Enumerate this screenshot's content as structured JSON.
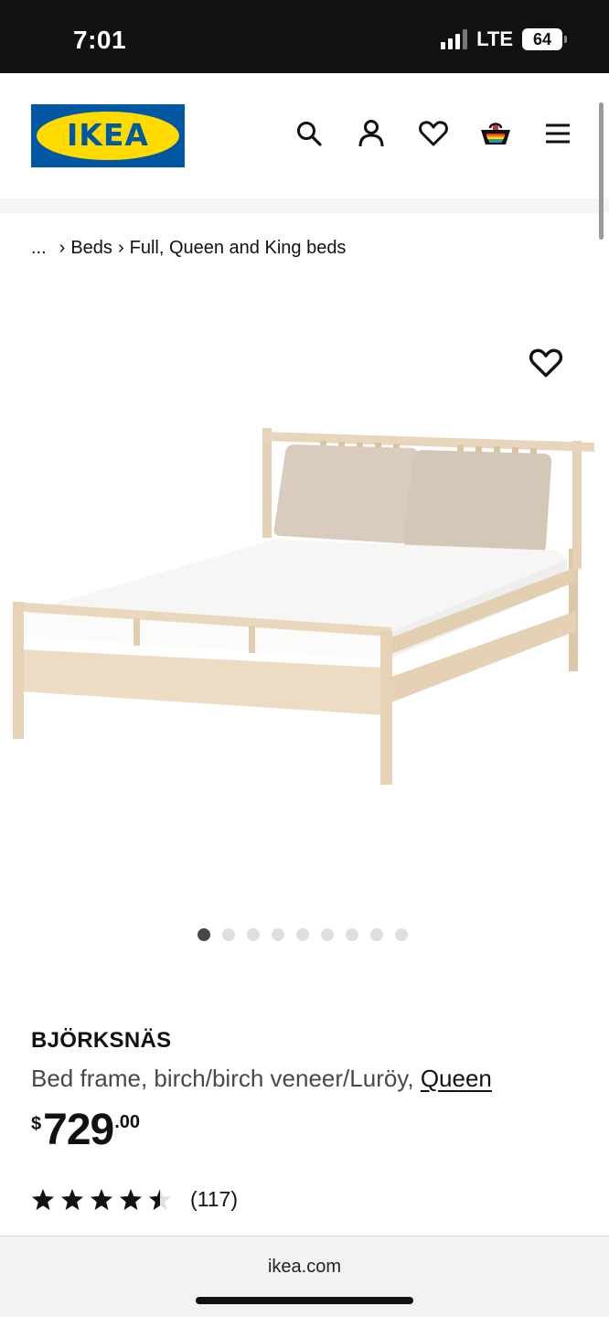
{
  "status_bar": {
    "time": "7:01",
    "network": "LTE",
    "battery": "64"
  },
  "header": {
    "logo_text": "IKEA",
    "icons": [
      "search-icon",
      "account-icon",
      "heart-icon",
      "cart-icon",
      "menu-icon"
    ]
  },
  "breadcrumb": {
    "ellipsis": "...",
    "items": [
      "Beds",
      "Full, Queen and King beds"
    ]
  },
  "gallery": {
    "image_alt": "BJÖRKSNÄS bed frame product photo",
    "dot_count": 9,
    "active_index": 0
  },
  "product": {
    "name": "BJÖRKSNÄS",
    "description": "Bed frame, birch/birch veneer/Luröy, ",
    "size": "Queen",
    "price_currency": "$",
    "price_integer": "729",
    "price_decimal": ".00",
    "rating_value": 4.5,
    "rating_max": 5,
    "review_count": "(117)"
  },
  "browser": {
    "url": "ikea.com"
  },
  "colors": {
    "ikea_blue": "#0058a3",
    "ikea_yellow": "#ffdb00",
    "wood": "#e8d6bc",
    "cushion": "#d8ccc0"
  }
}
